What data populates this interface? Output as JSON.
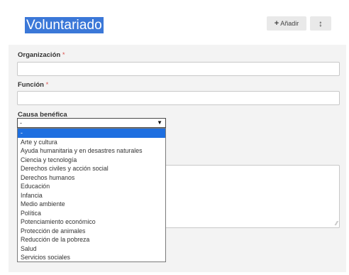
{
  "header": {
    "title": "Voluntariado",
    "add_label": "Añadir",
    "add_icon": "plus-icon",
    "sort_icon": "reorder-arrows-icon"
  },
  "form": {
    "organization_label": "Organización",
    "organization_value": "",
    "function_label": "Función",
    "function_value": "",
    "required_mark": "*",
    "cause_label": "Causa benéfica",
    "cause_selected": "-",
    "description_value": ""
  },
  "cause_options": [
    "-",
    "Arte y cultura",
    "Ayuda humanitaria y en desastres naturales",
    "Ciencia y tecnología",
    "Derechos civiles y acción social",
    "Derechos humanos",
    "Educación",
    "Infancia",
    "Medio ambiente",
    "Política",
    "Potenciamiento económico",
    "Protección de animales",
    "Reducción de la pobreza",
    "Salud",
    "Servicios sociales"
  ],
  "colors": {
    "title_highlight": "#3b78d8",
    "option_selected": "#1e6fe0",
    "required": "#d9534f"
  }
}
